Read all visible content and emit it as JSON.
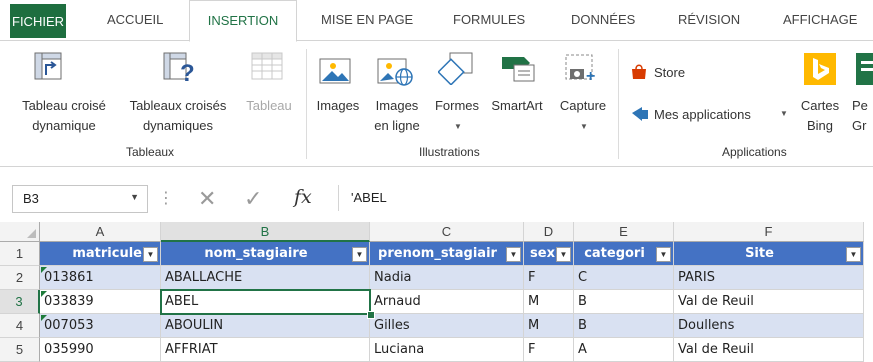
{
  "ribbon_tabs": [
    "FICHIER",
    "ACCUEIL",
    "INSERTION",
    "MISE EN PAGE",
    "FORMULES",
    "DONNÉES",
    "RÉVISION",
    "AFFICHAGE"
  ],
  "active_tab": "INSERTION",
  "groups": {
    "tableaux": {
      "label": "Tableaux",
      "buttons": [
        {
          "line1": "Tableau croisé",
          "line2": "dynamique",
          "icon": "pivot-table-icon"
        },
        {
          "line1": "Tableaux croisés",
          "line2": "dynamiques",
          "icon": "recommended-pivot-icon"
        },
        {
          "line1": "Tableau",
          "line2": "",
          "icon": "table-icon",
          "disabled": true
        }
      ]
    },
    "illustrations": {
      "label": "Illustrations",
      "buttons": [
        {
          "line1": "Images",
          "line2": "",
          "icon": "picture-icon"
        },
        {
          "line1": "Images",
          "line2": "en ligne",
          "icon": "online-picture-icon"
        },
        {
          "line1": "Formes",
          "line2": "",
          "icon": "shapes-icon"
        },
        {
          "line1": "SmartArt",
          "line2": "",
          "icon": "smartart-icon"
        },
        {
          "line1": "Capture",
          "line2": "",
          "icon": "screenshot-icon"
        }
      ]
    },
    "applications": {
      "label": "Applications",
      "store": "Store",
      "my_apps": "Mes applications",
      "bing_maps": {
        "line1": "Cartes",
        "line2": "Bing"
      },
      "people": {
        "line1": "Pe",
        "line2": "Gr"
      }
    }
  },
  "formula_bar": {
    "name_box": "B3",
    "cancel_glyph": "✕",
    "enter_glyph": "✓",
    "fx": "fx",
    "value": "'ABEL"
  },
  "columns": [
    "A",
    "B",
    "C",
    "D",
    "E",
    "F"
  ],
  "row_numbers": [
    "1",
    "2",
    "3",
    "4",
    "5"
  ],
  "table_headers": [
    "matricule",
    "nom_stagiaire",
    "prenom_stagiair",
    "sex",
    "categori",
    "Site"
  ],
  "rows": [
    [
      "013861",
      "ABALLACHE",
      "Nadia",
      "F",
      "C",
      "PARIS"
    ],
    [
      "033839",
      "ABEL",
      "Arnaud",
      "M",
      "B",
      "Val de Reuil"
    ],
    [
      "007053",
      "ABOULIN",
      "Gilles",
      "M",
      "B",
      "Doullens"
    ],
    [
      "035990",
      "AFFRIAT",
      "Luciana",
      "F",
      "A",
      "Val de Reuil"
    ]
  ],
  "colors": {
    "accent": "#217346",
    "file_tab": "#1e6e3f",
    "header_fill": "#4472c4",
    "band_fill": "#d9e1f2",
    "store": "#d83b01",
    "bing": "#ffb900"
  }
}
